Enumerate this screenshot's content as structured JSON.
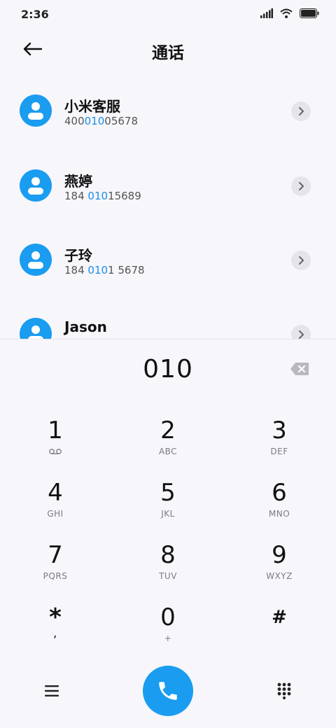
{
  "status_bar": {
    "time": "2:36"
  },
  "header": {
    "title": "通话"
  },
  "contacts": [
    {
      "name": "小米客服",
      "number_pre": "400",
      "number_match": "010",
      "number_post": "05678"
    },
    {
      "name": "燕婷",
      "number_pre": "184 ",
      "number_match": "010",
      "number_post": "15689"
    },
    {
      "name": "子玲",
      "number_pre": "184 ",
      "number_match": "010",
      "number_post": "1 5678"
    },
    {
      "name": "Jason",
      "number_pre": "",
      "number_match": "",
      "number_post": ""
    }
  ],
  "dialer": {
    "input_value": "010",
    "keys": [
      {
        "digit": "1",
        "letters": ""
      },
      {
        "digit": "2",
        "letters": "ABC"
      },
      {
        "digit": "3",
        "letters": "DEF"
      },
      {
        "digit": "4",
        "letters": "GHI"
      },
      {
        "digit": "5",
        "letters": "JKL"
      },
      {
        "digit": "6",
        "letters": "MNO"
      },
      {
        "digit": "7",
        "letters": "PQRS"
      },
      {
        "digit": "8",
        "letters": "TUV"
      },
      {
        "digit": "9",
        "letters": "WXYZ"
      },
      {
        "digit": "*",
        "letters": ","
      },
      {
        "digit": "0",
        "letters": "+"
      },
      {
        "digit": "#",
        "letters": ""
      }
    ]
  },
  "icons": {
    "back": "arrow-left-icon",
    "backspace": "backspace-icon",
    "voicemail": "voicemail-icon",
    "menu": "menu-icon",
    "call": "phone-icon",
    "keypad": "keypad-icon"
  },
  "colors": {
    "accent": "#1a9cf0",
    "match_highlight": "#1a8fe6",
    "background": "#f6f6fb"
  }
}
